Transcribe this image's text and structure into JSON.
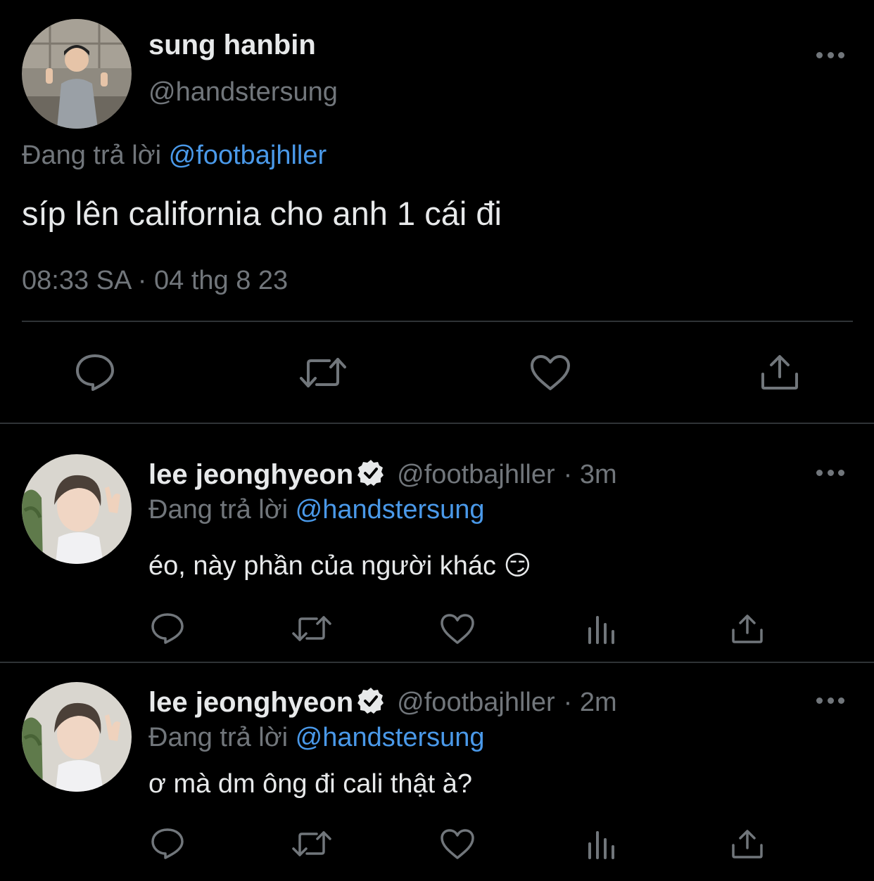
{
  "main_tweet": {
    "display_name": "sung hanbin",
    "handle": "@handstersung",
    "replying_prefix": "Đang trả lời",
    "replying_to": "@footbajhller",
    "text": "síp lên california cho anh 1 cái đi",
    "timestamp": "08:33 SA · 04 thg 8 23",
    "actions": [
      "reply-icon",
      "retweet-icon",
      "like-icon",
      "share-icon"
    ]
  },
  "replies": [
    {
      "display_name": "lee jeonghyeon",
      "verified": true,
      "handle": "@footbajhller",
      "time": "· 3m",
      "replying_prefix": "Đang trả lời",
      "replying_to": "@handstersung",
      "text": "éo, này phần của người khác 😏"
    },
    {
      "display_name": "lee jeonghyeon",
      "verified": true,
      "handle": "@footbajhller",
      "time": "· 2m",
      "replying_prefix": "Đang trả lời",
      "replying_to": "@handstersung",
      "text": "ơ mà dm ông đi cali thật à?"
    }
  ],
  "colors": {
    "background": "#000000",
    "text": "#e7e9ea",
    "muted": "#71767b",
    "link": "#4a99e9",
    "divider": "#2f3336"
  }
}
